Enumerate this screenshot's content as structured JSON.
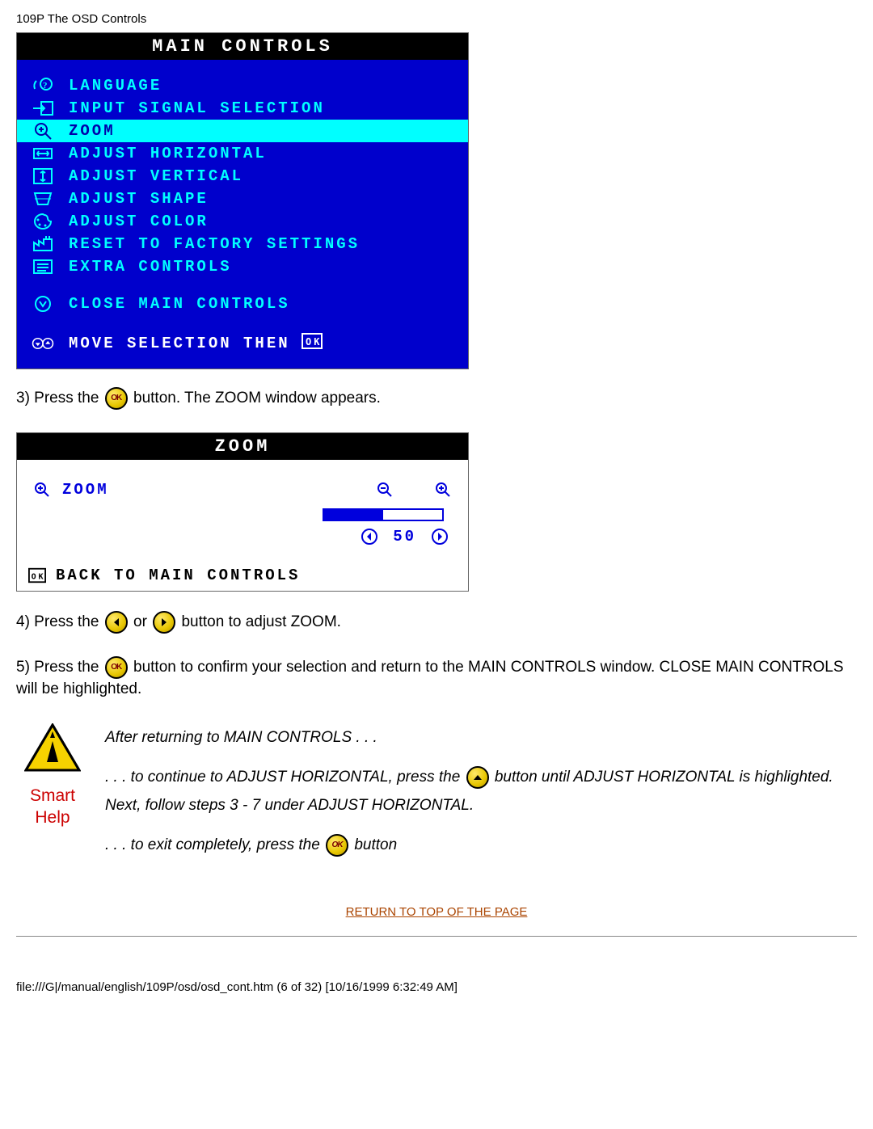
{
  "page_header": "109P The OSD Controls",
  "main_controls": {
    "title": "MAIN CONTROLS",
    "items": [
      {
        "label": "LANGUAGE"
      },
      {
        "label": "INPUT SIGNAL SELECTION"
      },
      {
        "label": "ZOOM"
      },
      {
        "label": "ADJUST HORIZONTAL"
      },
      {
        "label": "ADJUST VERTICAL"
      },
      {
        "label": "ADJUST SHAPE"
      },
      {
        "label": "ADJUST COLOR"
      },
      {
        "label": "RESET TO FACTORY SETTINGS"
      },
      {
        "label": "EXTRA CONTROLS"
      }
    ],
    "close_label": "CLOSE MAIN CONTROLS",
    "footer_label": "MOVE SELECTION THEN"
  },
  "step3": {
    "prefix": "3) Press the ",
    "suffix": " button. The ZOOM window appears."
  },
  "zoom_window": {
    "title": "ZOOM",
    "label": "ZOOM",
    "value": "50",
    "footer": "BACK TO MAIN CONTROLS"
  },
  "step4": {
    "prefix": "4) Press the ",
    "mid": " or ",
    "suffix": " button to adjust ZOOM."
  },
  "step5": {
    "prefix": "5) Press the ",
    "suffix": " button to confirm your selection and return to the MAIN CONTROLS window. CLOSE MAIN CONTROLS will be highlighted."
  },
  "smart_help": {
    "label_line1": "Smart",
    "label_line2": "Help",
    "p1": "After returning to MAIN CONTROLS . . .",
    "p2_a": ". . . to continue to ADJUST HORIZONTAL, press the ",
    "p2_b": " button until ADJUST HORIZONTAL is highlighted. Next, follow steps 3 - 7 under ADJUST HORIZONTAL.",
    "p3_a": ". . . to exit completely, press the ",
    "p3_b": " button"
  },
  "return_link": "RETURN TO TOP OF THE PAGE",
  "footer_path": "file:///G|/manual/english/109P/osd/osd_cont.htm (6 of 32) [10/16/1999 6:32:49 AM]"
}
